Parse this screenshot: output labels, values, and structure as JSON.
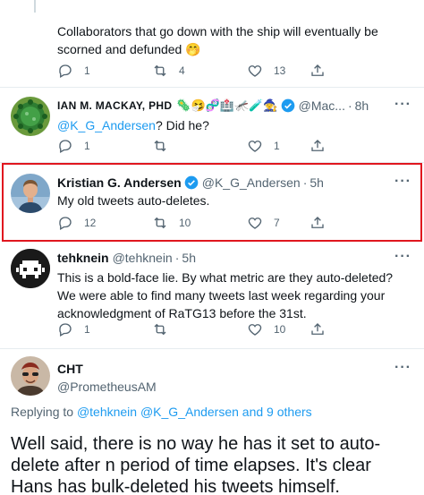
{
  "tweets": [
    {
      "text": "Collaborators that go down with the ship will eventually be scorned and defunded 🤭",
      "replies": "1",
      "retweets": "4",
      "likes": "13"
    },
    {
      "name": "IAN M. MACKAY, PHD",
      "name_emoji": "🦠🤧🧬🏥🦟🧪🧙",
      "handle": "@Mac...",
      "sep": "·",
      "time": "8h",
      "mention": "@K_G_Andersen",
      "text": "? Did he?",
      "replies": "1",
      "retweets": "",
      "likes": "1"
    },
    {
      "name": "Kristian G. Andersen",
      "handle": "@K_G_Andersen",
      "sep": "·",
      "time": "5h",
      "text": "My old tweets auto-deletes.",
      "replies": "12",
      "retweets": "10",
      "likes": "7"
    },
    {
      "name": "tehknein",
      "handle": "@tehknein",
      "sep": "·",
      "time": "5h",
      "text": "This is a bold-face lie. By what metric are they auto-deleted? We were able to find many tweets last week regarding your acknowledgment of RaTG13 before the 31st.",
      "replies": "1",
      "retweets": "",
      "likes": "10"
    },
    {
      "name": "CHT",
      "handle": "@PrometheusAM",
      "replying_label": "Replying to ",
      "replying_to": "@tehknein @K_G_Andersen and 9 others",
      "text": "Well said, there is no way he has it set to auto-delete after n period of time elapses. It's clear Hans has bulk-deleted his tweets himself."
    }
  ],
  "more_label": "···",
  "colors": {
    "accent": "#1d9bf0",
    "highlight": "#e0161f",
    "muted": "#536471"
  }
}
